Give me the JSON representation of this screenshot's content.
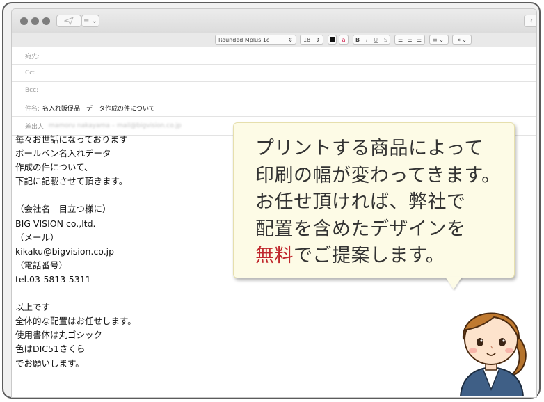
{
  "window": {
    "toolbar": {
      "list_button_label": "≡ ⌄"
    },
    "format_bar": {
      "font": "Rounded Mplus 1c",
      "size": "18",
      "bold": "B",
      "italic": "I",
      "underline": "U",
      "strike": "S",
      "list_label": "≡ ⌄",
      "indent_label": "⇥ ⌄"
    }
  },
  "headers": {
    "to_label": "宛先:",
    "cc_label": "Cc:",
    "bcc_label": "Bcc:",
    "subject_label": "件名:",
    "subject_value": "名入れ販促品　データ作成の件について",
    "from_label": "差出人:",
    "from_value": "mamoru nakayama – mail@bigvision.co.jp"
  },
  "body_lines": [
    "毎々お世話になっております",
    "ボールペン名入れデータ",
    "作成の件について、",
    "下記に記載させて頂きます。",
    "",
    "（会社名　目立つ様に）",
    "BIG VISION co.,ltd.",
    "（メール）",
    "kikaku@bigvision.co.jp",
    "（電話番号）",
    "tel.03-5813-5311",
    "",
    "以上です",
    "全体的な配置はお任せします。",
    "使用書体は丸ゴシック",
    "色はDIC51さくら",
    "でお願いします。"
  ],
  "bubble": {
    "line1": "プリントする商品によって",
    "line2": "印刷の幅が変わってきます。",
    "line3": "お任せ頂ければ、弊社で",
    "line4": "配置を含めたデザインを",
    "line5_highlight": "無料",
    "line5_rest": "でご提案します。",
    "highlight_color": "#c0282d"
  },
  "icons": {
    "send": "paper-plane-icon",
    "list": "list-icon",
    "avatar": "woman-avatar-illustration"
  }
}
